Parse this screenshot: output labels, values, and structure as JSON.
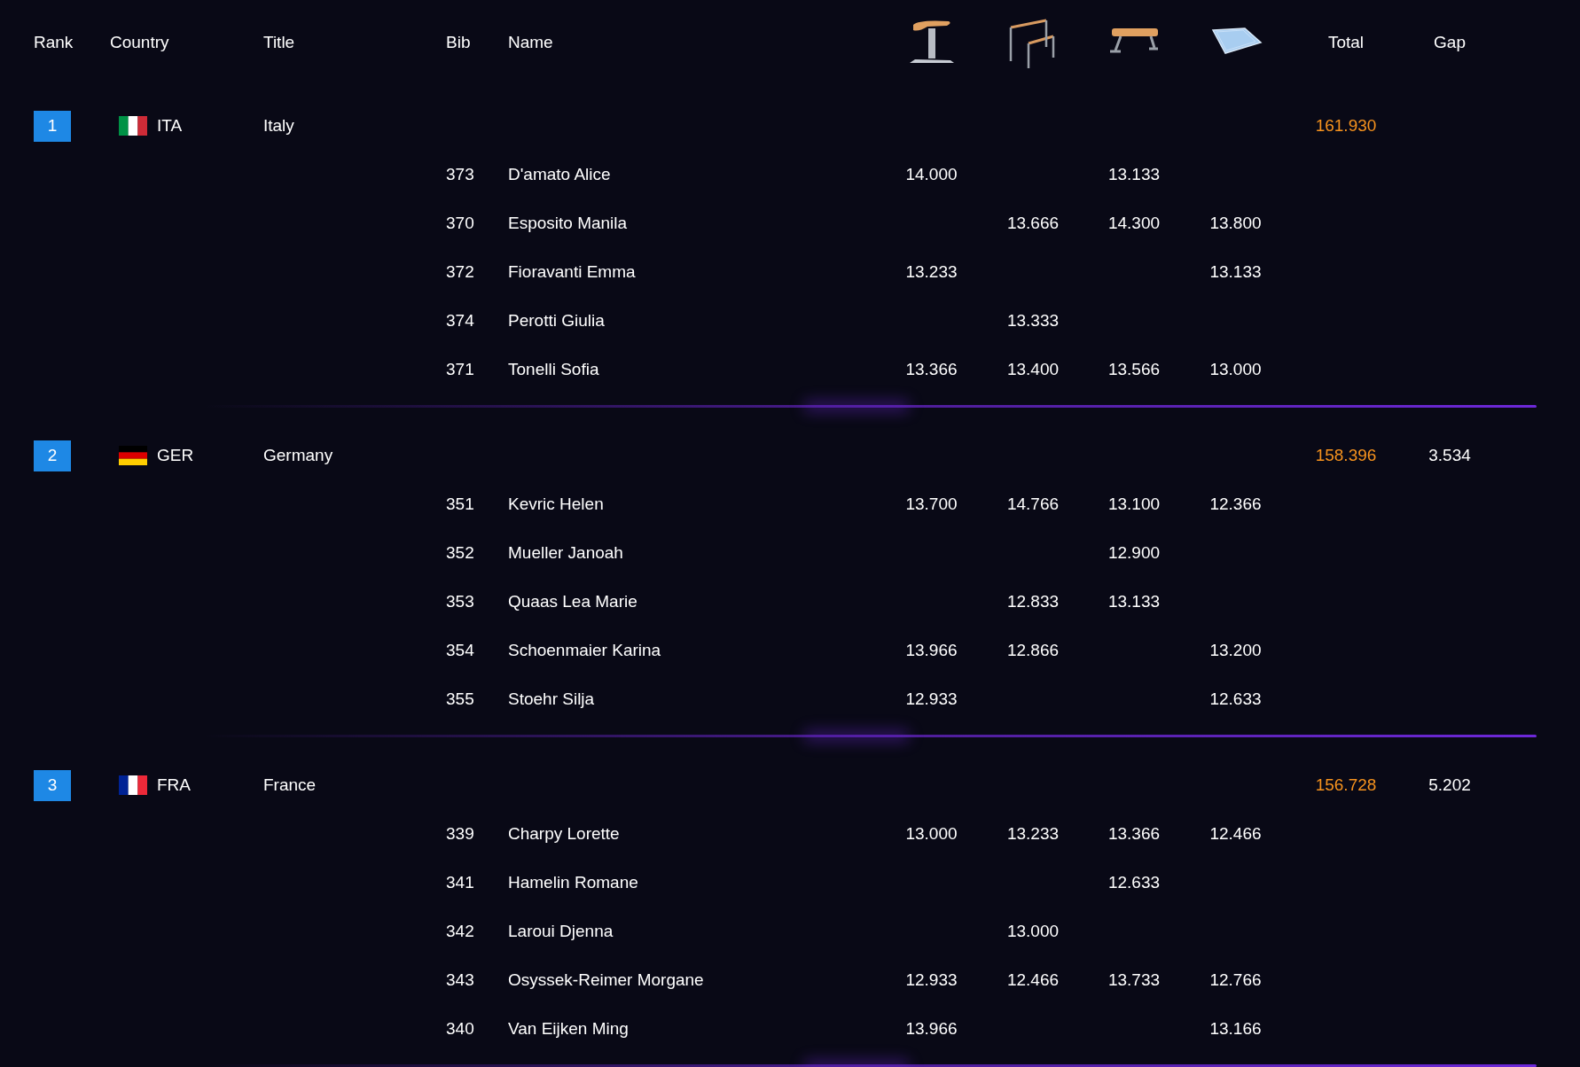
{
  "columns": {
    "rank": "Rank",
    "country": "Country",
    "title": "Title",
    "bib": "Bib",
    "name": "Name",
    "total": "Total",
    "gap": "Gap"
  },
  "teams": [
    {
      "rank": "1",
      "code": "ITA",
      "title": "Italy",
      "total": "161.930",
      "flag": {
        "kind": "italy"
      },
      "athletes": [
        {
          "bib": "373",
          "name": "D'amato Alice",
          "scores": {
            "vault": "14.000",
            "beam": "13.133"
          }
        },
        {
          "bib": "370",
          "name": "Esposito Manila",
          "scores": {
            "bars": "13.666",
            "beam": "14.300",
            "floor": "13.800"
          }
        },
        {
          "bib": "372",
          "name": "Fioravanti Emma",
          "scores": {
            "vault": "13.233",
            "floor": "13.133"
          }
        },
        {
          "bib": "374",
          "name": "Perotti Giulia",
          "scores": {
            "bars": "13.333"
          }
        },
        {
          "bib": "371",
          "name": "Tonelli Sofia",
          "scores": {
            "vault": "13.366",
            "bars": "13.400",
            "beam": "13.566",
            "floor": "13.000"
          }
        }
      ]
    },
    {
      "rank": "2",
      "code": "GER",
      "title": "Germany",
      "total": "158.396",
      "gap": "3.534",
      "flag": {
        "kind": "germany"
      },
      "athletes": [
        {
          "bib": "351",
          "name": "Kevric Helen",
          "scores": {
            "vault": "13.700",
            "bars": "14.766",
            "beam": "13.100",
            "floor": "12.366"
          }
        },
        {
          "bib": "352",
          "name": "Mueller Janoah",
          "scores": {
            "beam": "12.900"
          }
        },
        {
          "bib": "353",
          "name": "Quaas Lea Marie",
          "scores": {
            "bars": "12.833",
            "beam": "13.133"
          }
        },
        {
          "bib": "354",
          "name": "Schoenmaier Karina",
          "scores": {
            "vault": "13.966",
            "bars": "12.866",
            "floor": "13.200"
          }
        },
        {
          "bib": "355",
          "name": "Stoehr Silja",
          "scores": {
            "vault": "12.933",
            "floor": "12.633"
          }
        }
      ]
    },
    {
      "rank": "3",
      "code": "FRA",
      "title": "France",
      "total": "156.728",
      "gap": "5.202",
      "flag": {
        "kind": "france"
      },
      "athletes": [
        {
          "bib": "339",
          "name": "Charpy Lorette",
          "scores": {
            "vault": "13.000",
            "bars": "13.233",
            "beam": "13.366",
            "floor": "12.466"
          }
        },
        {
          "bib": "341",
          "name": "Hamelin Romane",
          "scores": {
            "beam": "12.633"
          }
        },
        {
          "bib": "342",
          "name": "Laroui Djenna",
          "scores": {
            "bars": "13.000"
          }
        },
        {
          "bib": "343",
          "name": "Osyssek-Reimer Morgane",
          "scores": {
            "vault": "12.933",
            "bars": "12.466",
            "beam": "13.733",
            "floor": "12.766"
          }
        },
        {
          "bib": "340",
          "name": "Van Eijken Ming",
          "scores": {
            "vault": "13.966",
            "floor": "13.166"
          }
        }
      ]
    }
  ]
}
